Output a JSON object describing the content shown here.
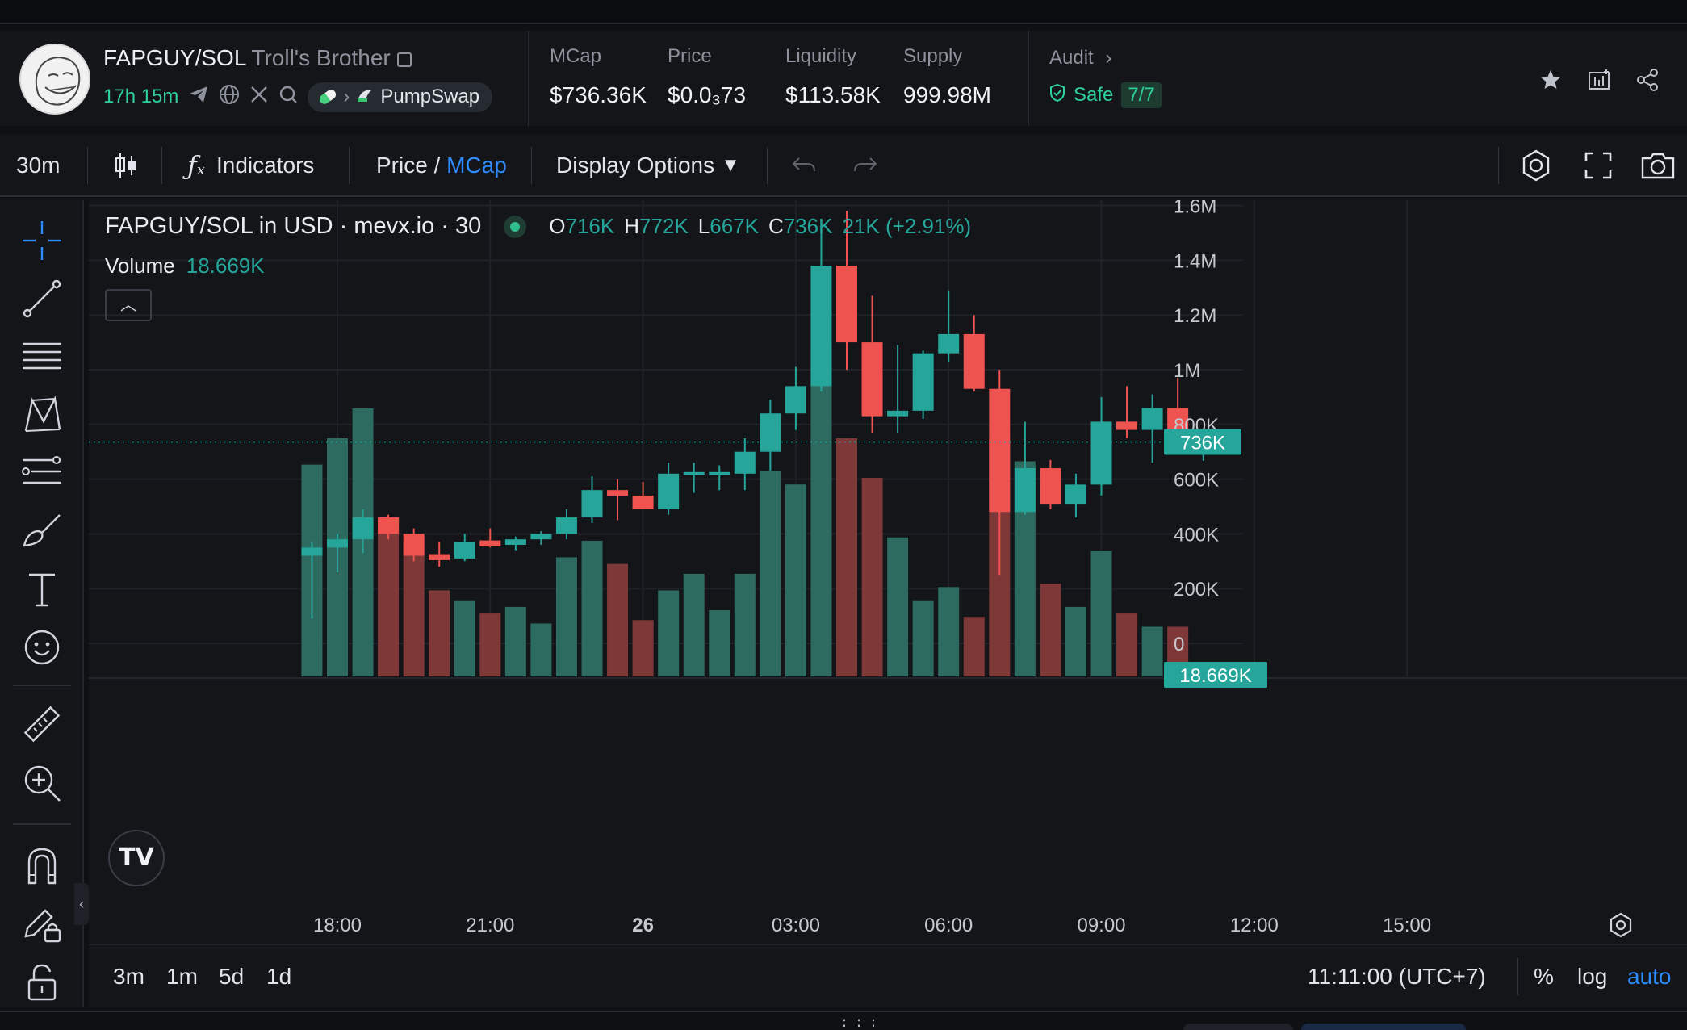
{
  "token": {
    "pair": "FAPGUY/SOL",
    "name": "Troll's Brother",
    "age": "17h 15m",
    "dex": "PumpSwap"
  },
  "stats": [
    {
      "label": "MCap",
      "value": "$736.36K"
    },
    {
      "label": "Price",
      "value": "$0.0₃73"
    },
    {
      "label": "Liquidity",
      "value": "$113.58K"
    },
    {
      "label": "Supply",
      "value": "999.98M"
    }
  ],
  "audit": {
    "label": "Audit",
    "status": "Safe",
    "score": "7/7"
  },
  "toolbar": {
    "interval": "30m",
    "indicators": "Indicators",
    "price": "Price",
    "slash": " / ",
    "mcap": "MCap",
    "display_options": "Display Options"
  },
  "legend": {
    "title": "FAPGUY/SOL in USD · mevx.io · 30",
    "o_label": "O",
    "o": "716K",
    "h_label": "H",
    "h": "772K",
    "l_label": "L",
    "l": "667K",
    "c_label": "C",
    "c": "736K",
    "change": "21K (+2.91%)",
    "volume_label": "Volume",
    "volume": "18.669K",
    "tv_logo": "TV"
  },
  "bottom_bar": {
    "ranges": [
      "3m",
      "1m",
      "5d",
      "1d"
    ],
    "time": "11:11:00 (UTC+7)",
    "percent": "%",
    "log": "log",
    "auto": "auto"
  },
  "colors": {
    "up": "#26a69a",
    "down": "#ef5350",
    "up_vol": "#2d6a5f",
    "down_vol": "#7f3838",
    "accent": "#2f8cff"
  },
  "chart_data": {
    "type": "candlestick",
    "y_ticks": [
      "1.6M",
      "1.4M",
      "1.2M",
      "1M",
      "800K",
      "600K",
      "400K",
      "200K",
      "0"
    ],
    "y_tick_values": [
      1600000,
      1400000,
      1200000,
      1000000,
      800000,
      600000,
      400000,
      200000,
      0
    ],
    "x_ticks": [
      "18:00",
      "21:00",
      "26",
      "03:00",
      "06:00",
      "09:00",
      "12:00",
      "15:00"
    ],
    "x_tick_hours": [
      18,
      21,
      24,
      27,
      30,
      33,
      36,
      39
    ],
    "last_price_label": "736K",
    "last_price": 736000,
    "volume_label": "18.669K",
    "candles": [
      {
        "t": 17.5,
        "o": 320000,
        "h": 370000,
        "l": 90000,
        "c": 350000,
        "v": 0.64
      },
      {
        "t": 18.0,
        "o": 350000,
        "h": 400000,
        "l": 260000,
        "c": 380000,
        "v": 0.72
      },
      {
        "t": 18.5,
        "o": 380000,
        "h": 490000,
        "l": 330000,
        "c": 460000,
        "v": 0.81
      },
      {
        "t": 19.0,
        "o": 460000,
        "h": 470000,
        "l": 380000,
        "c": 400000,
        "v": 0.48
      },
      {
        "t": 19.5,
        "o": 400000,
        "h": 420000,
        "l": 300000,
        "c": 320000,
        "v": 0.41
      },
      {
        "t": 20.0,
        "o": 320000,
        "h": 370000,
        "l": 280000,
        "c": 310000,
        "v": 0.26
      },
      {
        "t": 20.5,
        "o": 310000,
        "h": 400000,
        "l": 300000,
        "c": 370000,
        "v": 0.23
      },
      {
        "t": 21.0,
        "o": 370000,
        "h": 420000,
        "l": 350000,
        "c": 360000,
        "v": 0.19
      },
      {
        "t": 21.5,
        "o": 360000,
        "h": 390000,
        "l": 340000,
        "c": 380000,
        "v": 0.21
      },
      {
        "t": 22.0,
        "o": 380000,
        "h": 410000,
        "l": 360000,
        "c": 400000,
        "v": 0.16
      },
      {
        "t": 22.5,
        "o": 400000,
        "h": 490000,
        "l": 380000,
        "c": 460000,
        "v": 0.36
      },
      {
        "t": 23.0,
        "o": 460000,
        "h": 610000,
        "l": 440000,
        "c": 560000,
        "v": 0.41
      },
      {
        "t": 23.5,
        "o": 560000,
        "h": 600000,
        "l": 450000,
        "c": 540000,
        "v": 0.34
      },
      {
        "t": 24.0,
        "o": 540000,
        "h": 590000,
        "l": 490000,
        "c": 490000,
        "v": 0.17
      },
      {
        "t": 24.5,
        "o": 490000,
        "h": 660000,
        "l": 470000,
        "c": 620000,
        "v": 0.26
      },
      {
        "t": 25.0,
        "o": 620000,
        "h": 660000,
        "l": 550000,
        "c": 620000,
        "v": 0.31
      },
      {
        "t": 25.5,
        "o": 620000,
        "h": 650000,
        "l": 560000,
        "c": 620000,
        "v": 0.2
      },
      {
        "t": 26.0,
        "o": 620000,
        "h": 750000,
        "l": 560000,
        "c": 700000,
        "v": 0.31
      },
      {
        "t": 26.5,
        "o": 700000,
        "h": 890000,
        "l": 630000,
        "c": 840000,
        "v": 0.62
      },
      {
        "t": 27.0,
        "o": 840000,
        "h": 1010000,
        "l": 780000,
        "c": 940000,
        "v": 0.58
      },
      {
        "t": 27.5,
        "o": 940000,
        "h": 1520000,
        "l": 920000,
        "c": 1380000,
        "v": 1.0
      },
      {
        "t": 28.0,
        "o": 1380000,
        "h": 1580000,
        "l": 1000000,
        "c": 1100000,
        "v": 0.72
      },
      {
        "t": 28.5,
        "o": 1100000,
        "h": 1270000,
        "l": 770000,
        "c": 830000,
        "v": 0.6
      },
      {
        "t": 29.0,
        "o": 830000,
        "h": 1090000,
        "l": 770000,
        "c": 850000,
        "v": 0.42
      },
      {
        "t": 29.5,
        "o": 850000,
        "h": 1070000,
        "l": 820000,
        "c": 1060000,
        "v": 0.23
      },
      {
        "t": 30.0,
        "o": 1060000,
        "h": 1290000,
        "l": 1030000,
        "c": 1130000,
        "v": 0.27
      },
      {
        "t": 30.5,
        "o": 1130000,
        "h": 1200000,
        "l": 920000,
        "c": 930000,
        "v": 0.18
      },
      {
        "t": 31.0,
        "o": 930000,
        "h": 1000000,
        "l": 250000,
        "c": 480000,
        "v": 0.72
      },
      {
        "t": 31.5,
        "o": 480000,
        "h": 810000,
        "l": 470000,
        "c": 640000,
        "v": 0.65
      },
      {
        "t": 32.0,
        "o": 640000,
        "h": 670000,
        "l": 490000,
        "c": 510000,
        "v": 0.28
      },
      {
        "t": 32.5,
        "o": 510000,
        "h": 620000,
        "l": 460000,
        "c": 580000,
        "v": 0.21
      },
      {
        "t": 33.0,
        "o": 580000,
        "h": 900000,
        "l": 540000,
        "c": 810000,
        "v": 0.38
      },
      {
        "t": 33.5,
        "o": 810000,
        "h": 940000,
        "l": 750000,
        "c": 780000,
        "v": 0.19
      },
      {
        "t": 34.0,
        "o": 780000,
        "h": 910000,
        "l": 660000,
        "c": 860000,
        "v": 0.15
      },
      {
        "t": 34.5,
        "o": 860000,
        "h": 970000,
        "l": 710000,
        "c": 720000,
        "v": 0.15
      },
      {
        "t": 35.0,
        "o": 716000,
        "h": 772000,
        "l": 667000,
        "c": 736000,
        "v": 0.04
      }
    ]
  }
}
